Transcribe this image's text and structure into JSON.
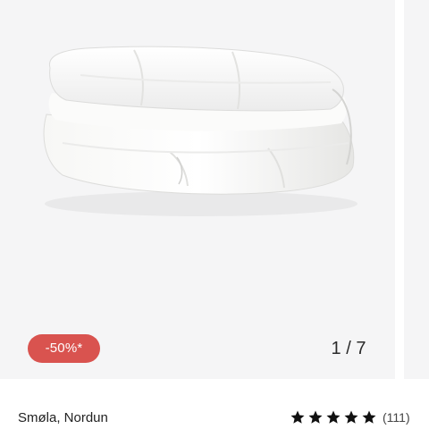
{
  "carousel": {
    "badge": "-50%*",
    "counter": "1 / 7",
    "current_index": 1,
    "total": 7
  },
  "product": {
    "name": "Smøla, Nordun",
    "rating": 5,
    "review_count": "(111)",
    "image_icon": "duvet-image"
  },
  "colors": {
    "badge_bg": "#d9534f",
    "image_bg": "#f5f5f6",
    "star": "#111111"
  }
}
